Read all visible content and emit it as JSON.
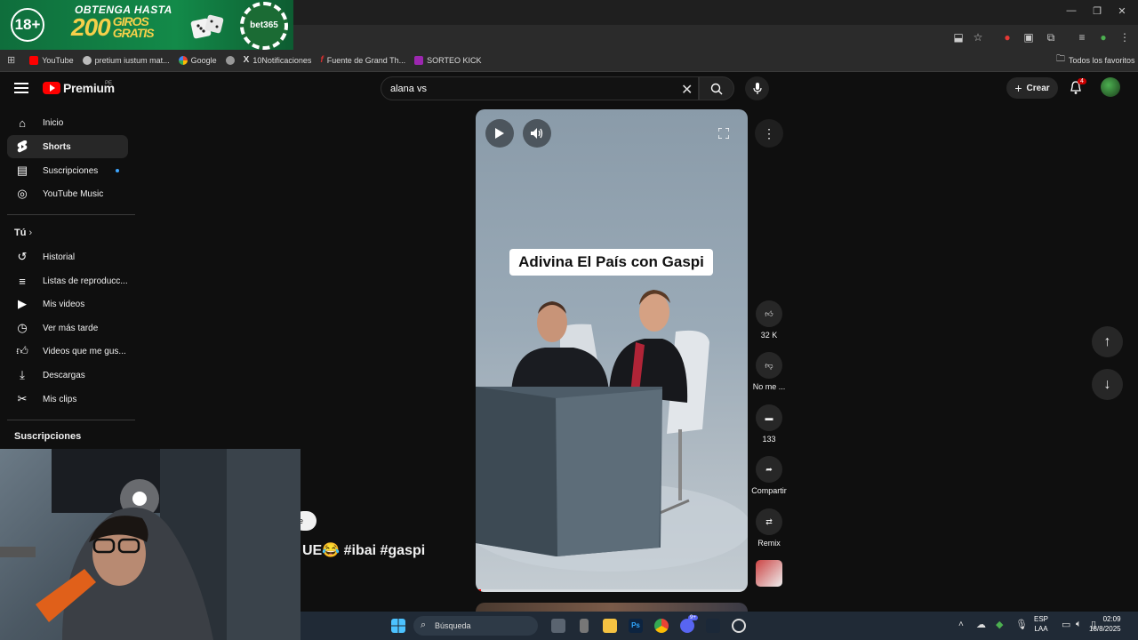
{
  "ad": {
    "age_label": "18+",
    "line1": "OBTENGA HASTA",
    "big_number": "200",
    "line2a": "GIROS",
    "line2b": "GRATIS",
    "brand": "bet365"
  },
  "bookmarks": [
    {
      "label": "YouTube",
      "icon": "youtube-icon",
      "color": "#ff0000"
    },
    {
      "label": "pretium iustum mat...",
      "icon": "globe-icon",
      "color": "#bbbbbb"
    },
    {
      "label": "Google",
      "icon": "google-icon",
      "color": "#4285f4"
    },
    {
      "label": "",
      "icon": "globe-icon",
      "color": "#999999"
    },
    {
      "label": "10Notificaciones",
      "icon": "x-icon",
      "color": "#ffffff"
    },
    {
      "label": "Fuente de Grand Th...",
      "icon": "f-icon",
      "color": "#d32f2f"
    },
    {
      "label": "SORTEO KICK",
      "icon": "kick-icon",
      "color": "#9c27b0"
    }
  ],
  "bookmarks_all": "Todos los favoritos",
  "youtube": {
    "logo_text": "Premium",
    "region": "PE",
    "search_value": "alana vs",
    "create_label": "Crear",
    "notif_count": "4"
  },
  "sidebar": {
    "items_main": [
      {
        "label": "Inicio",
        "icon": "home-icon"
      },
      {
        "label": "Shorts",
        "icon": "shorts-icon"
      },
      {
        "label": "Suscripciones",
        "icon": "subscriptions-icon"
      },
      {
        "label": "YouTube Music",
        "icon": "music-icon"
      }
    ],
    "you_label": "Tú",
    "items_you": [
      {
        "label": "Historial",
        "icon": "history-icon"
      },
      {
        "label": "Listas de reproducc...",
        "icon": "playlist-icon"
      },
      {
        "label": "Mis videos",
        "icon": "video-icon"
      },
      {
        "label": "Ver más tarde",
        "icon": "clock-icon"
      },
      {
        "label": "Videos que me gus...",
        "icon": "like-icon"
      },
      {
        "label": "Descargas",
        "icon": "download-icon"
      },
      {
        "label": "Mis clips",
        "icon": "scissors-icon"
      }
    ],
    "subs_label": "Suscripciones"
  },
  "short": {
    "caption": "Adivina El País con Gaspi",
    "title": "UE😂 #ibai #gaspi",
    "chip": "e",
    "progress": 0.02
  },
  "actions": {
    "like_count": "32 K",
    "dislike_label": "No me ...",
    "comments_count": "133",
    "share_label": "Compartir",
    "remix_label": "Remix"
  },
  "taskbar": {
    "search_label": "Búsqueda",
    "lang_line1": "ESP",
    "lang_line2": "LAA",
    "time": "02:09",
    "date": "18/8/2025",
    "discord_badge": "9+"
  }
}
